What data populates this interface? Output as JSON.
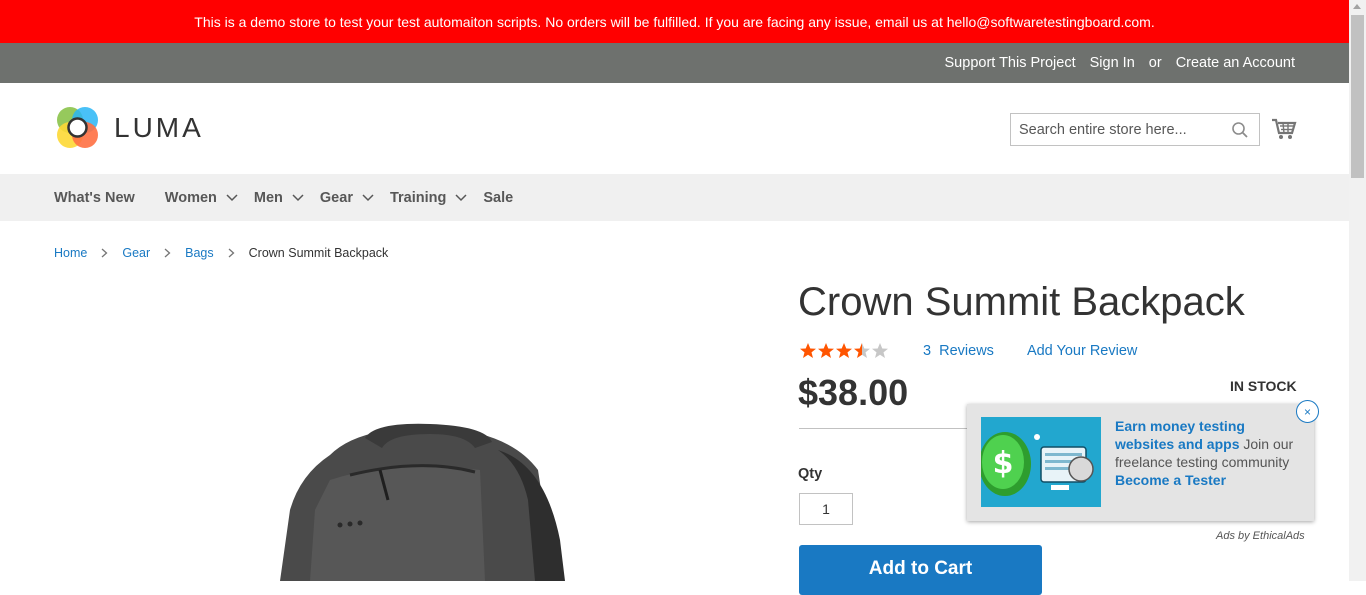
{
  "banner": {
    "text": "This is a demo store to test your test automaiton scripts. No orders will be fulfilled. If you are facing any issue, email us at hello@softwaretestingboard.com."
  },
  "top_links": {
    "support": "Support This Project",
    "sign_in": "Sign In",
    "or": "or",
    "create_account": "Create an Account"
  },
  "logo": {
    "text": "LUMA"
  },
  "search": {
    "placeholder": "Search entire store here..."
  },
  "nav": {
    "items": [
      {
        "label": "What's New",
        "dropdown": false
      },
      {
        "label": "Women",
        "dropdown": true
      },
      {
        "label": "Men",
        "dropdown": true
      },
      {
        "label": "Gear",
        "dropdown": true
      },
      {
        "label": "Training",
        "dropdown": true
      },
      {
        "label": "Sale",
        "dropdown": false
      }
    ]
  },
  "breadcrumbs": {
    "items": [
      "Home",
      "Gear",
      "Bags"
    ],
    "current": "Crown Summit Backpack"
  },
  "product": {
    "title": "Crown Summit Backpack",
    "rating_fraction": 0.6,
    "reviews_count": "3",
    "reviews_label": "Reviews",
    "add_review": "Add Your Review",
    "price": "$38.00",
    "stock": "IN STOCK",
    "qty_label": "Qty",
    "qty_value": "1",
    "add_to_cart": "Add to Cart"
  },
  "ad": {
    "headline": "Earn money testing websites and apps",
    "body": " Join our freelance testing community ",
    "cta": "Become a Tester",
    "by": "Ads by EthicalAds",
    "close": "×"
  },
  "colors": {
    "banner": "#ff0000",
    "top_bar": "#6e716e",
    "accent": "#1979c3",
    "star_on": "#ff5501",
    "star_off": "#c7c7c7"
  }
}
